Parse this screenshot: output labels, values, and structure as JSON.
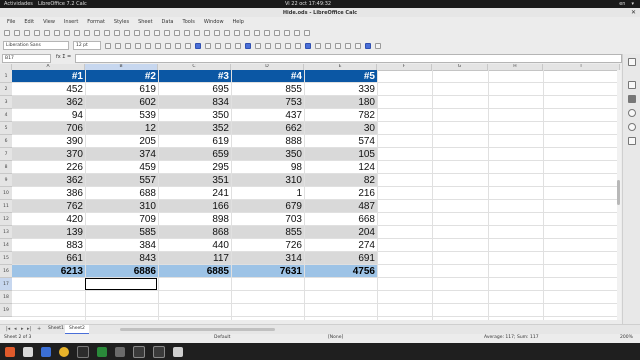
{
  "system": {
    "activities": "Actividades",
    "clock": "Vi 22 oct  17:49:32",
    "tray": [
      "en",
      "▾"
    ]
  },
  "window": {
    "title": "Hide.ods - LibreOffice Calc",
    "app_name": "LibreOffice 7.2 Calc"
  },
  "menu": [
    "File",
    "Edit",
    "View",
    "Insert",
    "Format",
    "Styles",
    "Sheet",
    "Data",
    "Tools",
    "Window",
    "Help"
  ],
  "toolbar": {
    "font_name": "Liberation Sans",
    "font_size": "12 pt"
  },
  "formula_bar": {
    "name_box": "B17",
    "fx_label": "fx  Σ  =",
    "formula": ""
  },
  "spreadsheet": {
    "columns": [
      "A",
      "B",
      "C",
      "D",
      "E",
      "F",
      "G",
      "H",
      "I"
    ],
    "selected_column": "B",
    "selected_row": "17",
    "headers": [
      "#1",
      "#2",
      "#3",
      "#4",
      "#5"
    ],
    "rows": [
      [
        "452",
        "619",
        "695",
        "855",
        "339"
      ],
      [
        "362",
        "602",
        "834",
        "753",
        "180"
      ],
      [
        "94",
        "539",
        "350",
        "437",
        "782"
      ],
      [
        "706",
        "12",
        "352",
        "662",
        "30"
      ],
      [
        "390",
        "205",
        "619",
        "888",
        "574"
      ],
      [
        "370",
        "374",
        "659",
        "350",
        "105"
      ],
      [
        "226",
        "459",
        "295",
        "98",
        "124"
      ],
      [
        "362",
        "557",
        "351",
        "310",
        "82"
      ],
      [
        "386",
        "688",
        "241",
        "1",
        "216"
      ],
      [
        "762",
        "310",
        "166",
        "679",
        "487"
      ],
      [
        "420",
        "709",
        "898",
        "703",
        "668"
      ],
      [
        "139",
        "585",
        "868",
        "855",
        "204"
      ],
      [
        "883",
        "384",
        "440",
        "726",
        "274"
      ],
      [
        "661",
        "843",
        "117",
        "314",
        "691"
      ]
    ],
    "totals": [
      "6213",
      "6886",
      "6885",
      "7631",
      "4756"
    ],
    "row_numbers": [
      "1",
      "2",
      "3",
      "4",
      "5",
      "6",
      "7",
      "8",
      "9",
      "10",
      "11",
      "12",
      "13",
      "14",
      "15",
      "16",
      "17",
      "18",
      "19"
    ],
    "header_color": "#0b57a4",
    "alt_row_color": "#d9d9d9",
    "total_row_color": "#9dc3e6"
  },
  "sheet_tabs": [
    "Sheet1",
    "Sheet2"
  ],
  "active_tab": "Sheet2",
  "status": {
    "sheet": "Sheet 2 of 3",
    "style": "Default",
    "lang": "[None]",
    "summary": "Average: 117; Sum: 117",
    "zoom": "200%"
  }
}
